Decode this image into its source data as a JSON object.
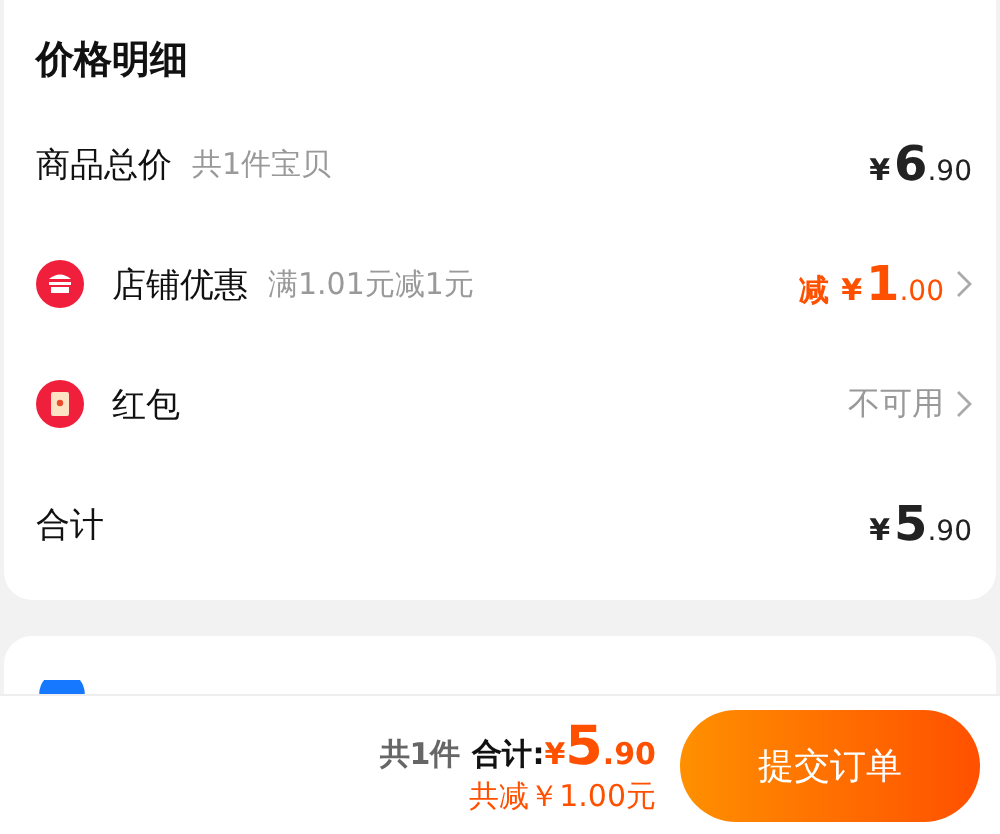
{
  "title": "价格明细",
  "rows": [
    {
      "kind": "total",
      "label": "商品总价",
      "note": "共1件宝贝",
      "price": {
        "currency": "¥",
        "integer": "6",
        "decimal": ".90"
      }
    },
    {
      "kind": "shop",
      "label": "店铺优惠",
      "note": "满1.01元减1元",
      "price": {
        "prefix": "减",
        "currency": "¥",
        "integer": "1",
        "decimal": ".00"
      },
      "chevron": true
    },
    {
      "kind": "packet",
      "label": "红包",
      "status": "不可用",
      "chevron": true
    },
    {
      "kind": "sum",
      "label": "合计",
      "price": {
        "currency": "¥",
        "integer": "5",
        "decimal": ".90"
      }
    }
  ],
  "footer": {
    "count": "共1件",
    "total_label": "合计:",
    "currency": "¥",
    "integer": "5",
    "decimal": ".90",
    "saving": "共减￥1.00元",
    "submit": "提交订单"
  }
}
